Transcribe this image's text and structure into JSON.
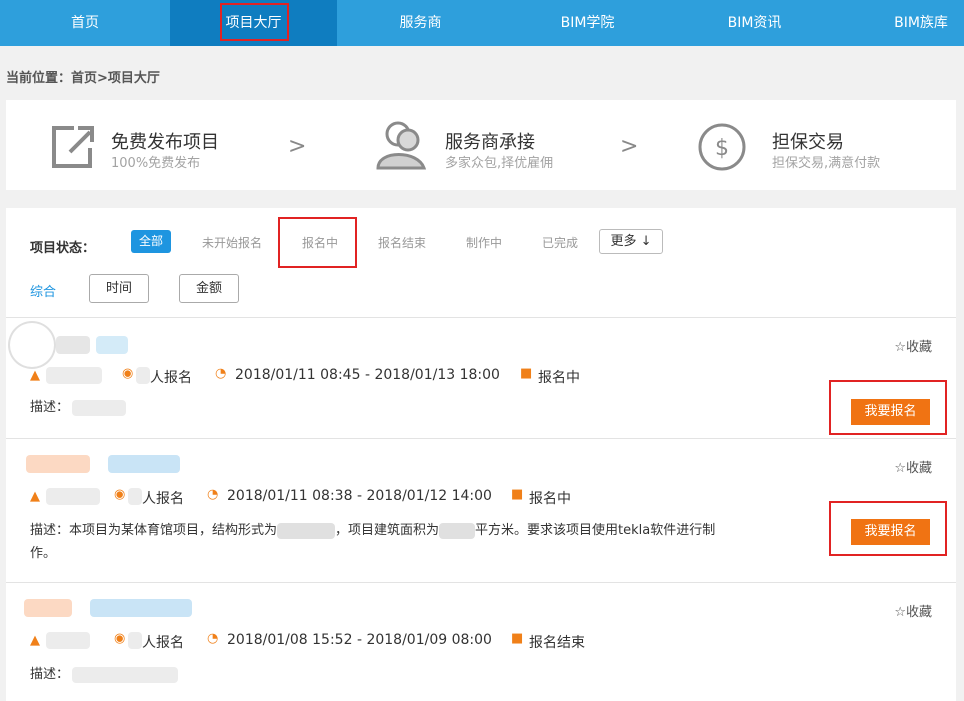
{
  "nav": {
    "items": [
      {
        "label": "首页"
      },
      {
        "label": "项目大厅"
      },
      {
        "label": "服务商"
      },
      {
        "label": "BIM学院"
      },
      {
        "label": "BIM资讯"
      },
      {
        "label": "BIM族库"
      }
    ],
    "active_index": 1
  },
  "breadcrumb": "当前位置：首页>项目大厅",
  "steps": [
    {
      "title": "免费发布项目",
      "subtitle": "100%免费发布",
      "icon": "external-link-icon"
    },
    {
      "title": "服务商承接",
      "subtitle": "多家众包,择优雇佣",
      "icon": "user-group-icon"
    },
    {
      "title": "担保交易",
      "subtitle": "担保交易,满意付款",
      "icon": "dollar-circle-icon"
    }
  ],
  "step_arrow": ">",
  "filter": {
    "label": "项目状态：",
    "statuses": [
      "全部",
      "未开始报名",
      "报名中",
      "报名结束",
      "制作中",
      "已完成"
    ],
    "more": "更多 ↓"
  },
  "sort": {
    "tabs": [
      "综合",
      "时间",
      "金额"
    ]
  },
  "projects": [
    {
      "signup": "人报名",
      "time_range": "2018/01/11 08:45  -  2018/01/13 18:00",
      "status": "报名中",
      "desc_label": "描述：",
      "desc_line1": "",
      "desc_line2": "",
      "fav": "☆收藏",
      "button": "我要报名"
    },
    {
      "signup": "人报名",
      "time_range": "2018/01/11 08:38  -  2018/01/12 14:00",
      "status": "报名中",
      "desc_label": "描述：",
      "desc_line1": "本项目为某体育馆项目，结构形式为",
      "desc_mid1": "，项目建筑面积为",
      "desc_mid2": "平方米。要求该项目使用tekla软件进行制",
      "desc_line2": "作。",
      "fav": "☆收藏",
      "button": "我要报名"
    },
    {
      "signup": "人报名",
      "time_range": "2018/01/08 15:52  -  2018/01/09 08:00",
      "status": "报名结束",
      "desc_label": "描述：",
      "fav": "☆收藏"
    }
  ],
  "colors": {
    "nav_bg": "#2e9fdc",
    "nav_active": "#0f7dc0",
    "accent_orange": "#f07313",
    "highlight_red": "#e12323",
    "link_blue": "#1e95e0"
  }
}
